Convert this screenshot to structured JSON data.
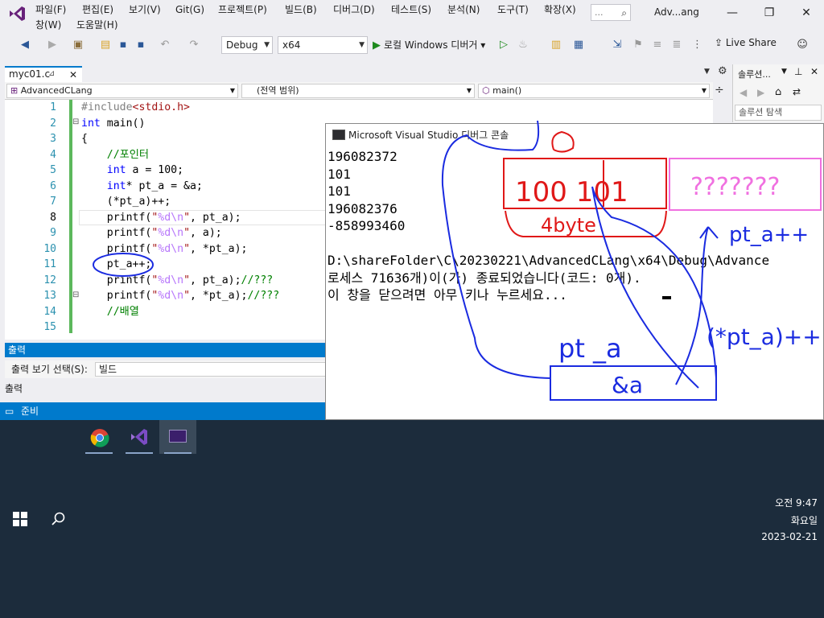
{
  "menu": {
    "items": [
      "파일(F)",
      "편집(E)",
      "보기(V)",
      "Git(G)",
      "프로젝트(P)",
      "빌드(B)",
      "디버그(D)",
      "테스트(S)",
      "분석(N)",
      "도구(T)",
      "확장(X)"
    ],
    "items_row2": [
      "창(W)",
      "도움말(H)"
    ],
    "search_placeholder": "...",
    "title": "Adv...ang"
  },
  "toolbar": {
    "config": "Debug",
    "platform": "x64",
    "run_label": "로컬 Windows 디버거",
    "live_share": "Live Share"
  },
  "editor": {
    "tab_name": "myc01.c",
    "nav_project": "AdvancedCLang",
    "nav_scope": "(전역 범위)",
    "nav_function": "main()",
    "line_numbers": [
      "1",
      "2",
      "3",
      "4",
      "5",
      "6",
      "7",
      "8",
      "9",
      "10",
      "11",
      "12",
      "13",
      "14",
      "15"
    ]
  },
  "output": {
    "title": "출력",
    "select_label": "출력 보기 선택(S):",
    "select_value": "빌드",
    "tab_label": "출력"
  },
  "status": {
    "text": "준비"
  },
  "solution": {
    "title": "솔루션...",
    "search": "솔루션 탐색"
  },
  "console": {
    "title": "Microsoft Visual Studio 디버그 콘솔",
    "lines": [
      "196082372",
      "101",
      "101",
      "196082376",
      "-858993460",
      "",
      "D:\\shareFolder\\C\\20230221\\AdvancedCLang\\x64\\Debug\\Advance",
      "로세스 71636개)이(가) 종료되었습니다(코드: 0개).",
      "이 창을 닫으려면 아무 키나 누르세요..."
    ]
  },
  "annotations": {
    "box_text": "100 101",
    "pink_text": "???????",
    "size_text": "4byte",
    "ptpp_label": "pt_a++",
    "pta_label": "pt _a",
    "addr_label": "&a",
    "deref_label": "(*pt_a)++"
  },
  "taskbar": {
    "apps": [
      "chrome",
      "visual-studio",
      "console"
    ],
    "time": "오전 9:47",
    "weekday": "화요일",
    "date": "2023-02-21"
  },
  "colors": {
    "accent": "#007acc",
    "ink_blue": "#1a2be0",
    "ink_red": "#e01818",
    "ink_pink": "#f070e0"
  }
}
